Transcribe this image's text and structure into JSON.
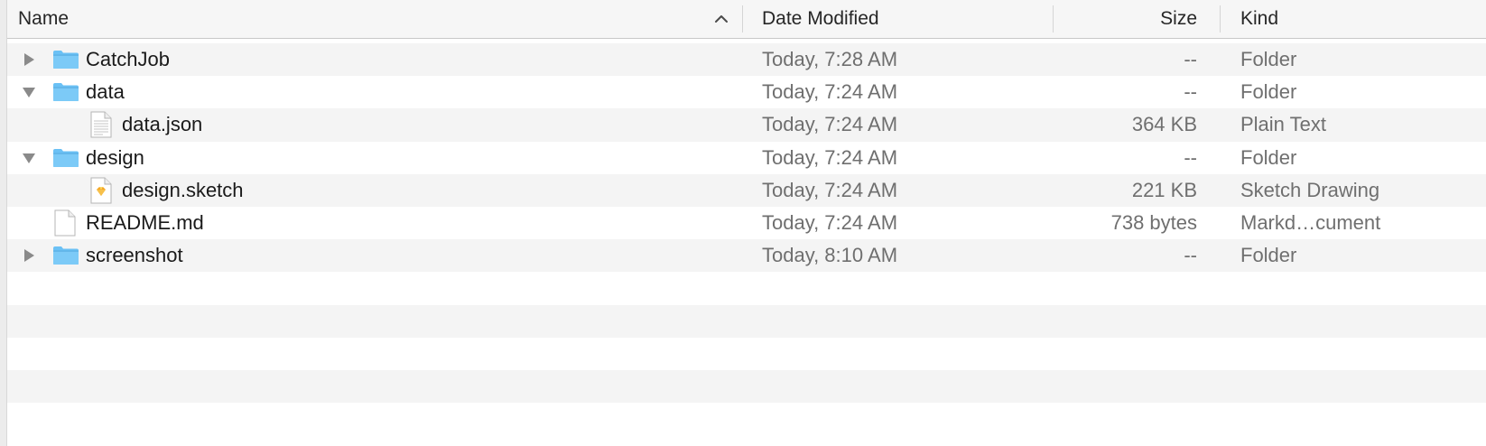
{
  "columns": {
    "name": "Name",
    "date_modified": "Date Modified",
    "size": "Size",
    "kind": "Kind"
  },
  "sort": {
    "column": "Name",
    "direction": "ascending",
    "icon": "chevron-up-icon"
  },
  "colors": {
    "folder": "#6bc1f5",
    "stripe": "#f4f4f4",
    "secondary_text": "#6f6f6f"
  },
  "rows": [
    {
      "name": "CatchJob",
      "date": "Today, 7:28 AM",
      "size": "--",
      "kind": "Folder",
      "type": "folder",
      "disclosure": "collapsed",
      "depth": 0
    },
    {
      "name": "data",
      "date": "Today, 7:24 AM",
      "size": "--",
      "kind": "Folder",
      "type": "folder",
      "disclosure": "expanded",
      "depth": 0
    },
    {
      "name": "data.json",
      "date": "Today, 7:24 AM",
      "size": "364 KB",
      "kind": "Plain Text",
      "type": "text-file",
      "disclosure": "none",
      "depth": 1
    },
    {
      "name": "design",
      "date": "Today, 7:24 AM",
      "size": "--",
      "kind": "Folder",
      "type": "folder",
      "disclosure": "expanded",
      "depth": 0
    },
    {
      "name": "design.sketch",
      "date": "Today, 7:24 AM",
      "size": "221 KB",
      "kind": "Sketch Drawing",
      "type": "sketch-file",
      "disclosure": "none",
      "depth": 1
    },
    {
      "name": "README.md",
      "date": "Today, 7:24 AM",
      "size": "738 bytes",
      "kind": "Markd…cument",
      "type": "blank-file",
      "disclosure": "none",
      "depth": 0
    },
    {
      "name": "screenshot",
      "date": "Today, 8:10 AM",
      "size": "--",
      "kind": "Folder",
      "type": "folder",
      "disclosure": "collapsed",
      "depth": 0
    }
  ]
}
